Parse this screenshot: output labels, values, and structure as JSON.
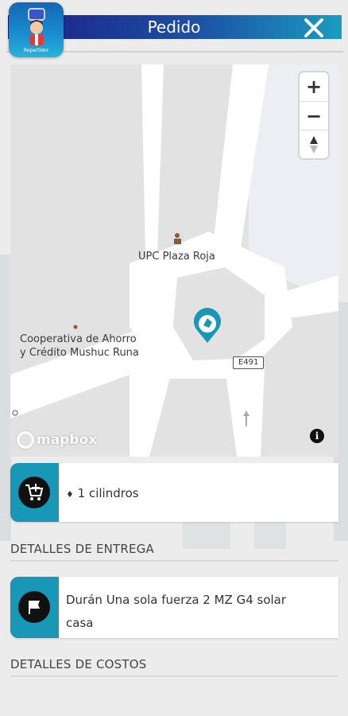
{
  "header": {
    "title": "Pedido",
    "logo_text": "Repartidor"
  },
  "map": {
    "labels": {
      "upc": "UPC Plaza Roja",
      "coop_line1": "Cooperativa de Ahorro",
      "coop_line2": "y Crédito Mushuc Runa",
      "road": "E491"
    },
    "attribution": "mapbox",
    "zoom_in": "+",
    "zoom_out": "−",
    "info": "i"
  },
  "order": {
    "items": [
      {
        "bullet": "♦",
        "text": "1 cilindros"
      }
    ]
  },
  "delivery": {
    "section_title": "DETALLES DE ENTREGA",
    "address_line1": "Durán Una sola fuerza 2 MZ G4 solar",
    "address_line2": "casa"
  },
  "costs": {
    "section_title": "DETALLES DE COSTOS"
  },
  "colors": {
    "header_start": "#1b1f86",
    "header_end": "#1a9cc0",
    "accent": "#1897b6"
  }
}
